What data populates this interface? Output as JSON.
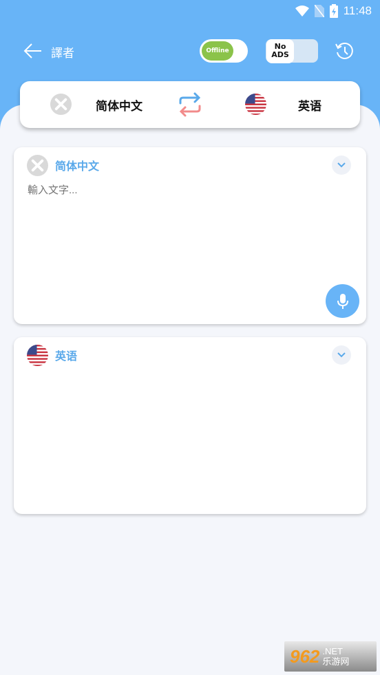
{
  "status_bar": {
    "time": "11:48",
    "icons": [
      "wifi-icon",
      "no-sim-icon",
      "battery-charging-icon"
    ]
  },
  "header": {
    "title": "譯者",
    "offline_label": "Offline",
    "no_ads_label": "No ADS",
    "icons": [
      "back-arrow-icon",
      "history-icon"
    ]
  },
  "language_bar": {
    "source": "简体中文",
    "target": "英语",
    "icons": [
      "source-flag-placeholder-icon",
      "swap-icon",
      "us-flag-icon"
    ]
  },
  "input_card": {
    "language": "简体中文",
    "placeholder": "輸入文字...",
    "value": ""
  },
  "output_card": {
    "language": "英语",
    "value": ""
  },
  "watermark": {
    "text": "962.NET 乐游网"
  },
  "colors": {
    "primary": "#68b4f7",
    "offline_green": "#8bc34a",
    "label_blue": "#5aa9ea",
    "swap_red": "#f28b8b"
  }
}
